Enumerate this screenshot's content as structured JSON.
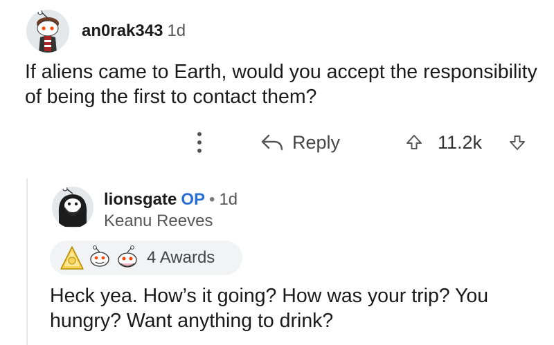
{
  "parent_comment": {
    "username": "an0rak343",
    "age": "1d",
    "body": "If aliens came to Earth, would you accept the responsibility of being the first to contact them?",
    "actions": {
      "reply_label": "Reply",
      "score": "11.2k"
    },
    "icons": {
      "more": "more-options-icon",
      "reply": "reply-arrow-icon",
      "upvote": "upvote-icon",
      "downvote": "downvote-icon"
    }
  },
  "reply_comment": {
    "username": "lionsgate",
    "op_badge": "OP",
    "separator": "•",
    "age": "1d",
    "flair": "Keanu Reeves",
    "awards": {
      "label": "4 Awards",
      "icons": [
        "gold-award-icon",
        "snoo-award-icon",
        "wholesome-award-icon"
      ]
    },
    "body": "Heck yea. How’s it going? How was your trip? You hungry? Want anything to drink?"
  },
  "colors": {
    "text": "#1a1a1b",
    "muted": "#555555",
    "op_blue": "#2a6fd6",
    "pill_bg": "#f2f3f5",
    "thread_line": "#e6e6e6"
  }
}
